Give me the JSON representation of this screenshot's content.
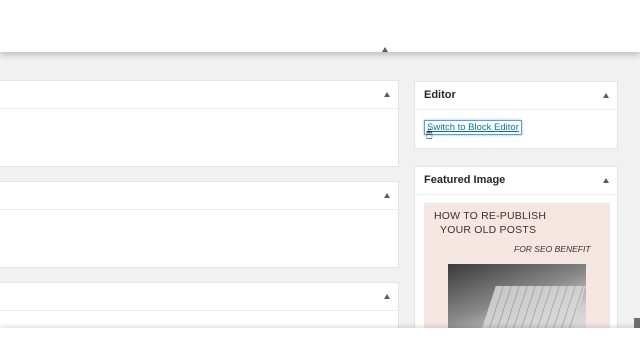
{
  "editor_panel": {
    "title": "Editor",
    "switch_link": "Switch to Block Editor"
  },
  "featured_image_panel": {
    "title": "Featured Image",
    "image_text": {
      "line1": "HOW TO RE-PUBLISH",
      "line2": "YOUR OLD POSTS",
      "line3": "FOR SEO BENEFIT"
    }
  },
  "icons": {
    "toggle": "triangle-up-icon",
    "cursor": "mouse-pointer-icon"
  },
  "colors": {
    "link": "#0073aa",
    "background": "#f1f1f1",
    "panel": "#ffffff"
  }
}
